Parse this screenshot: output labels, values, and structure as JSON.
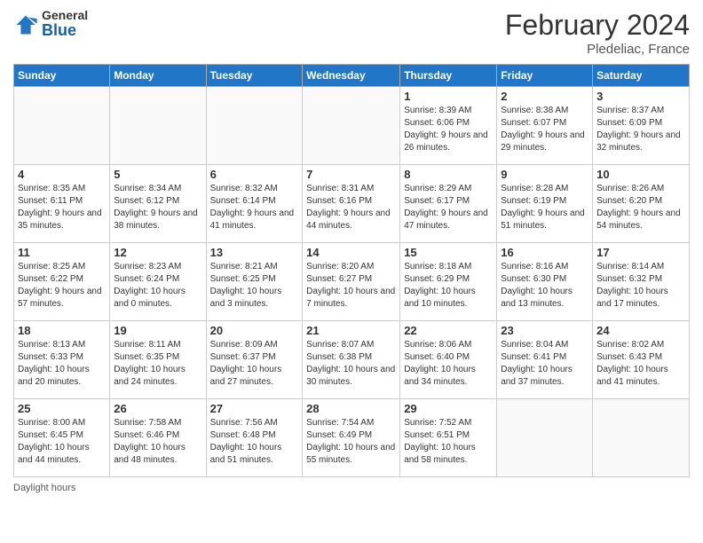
{
  "logo": {
    "general": "General",
    "blue": "Blue"
  },
  "header": {
    "month": "February 2024",
    "location": "Pledeliac, France"
  },
  "weekdays": [
    "Sunday",
    "Monday",
    "Tuesday",
    "Wednesday",
    "Thursday",
    "Friday",
    "Saturday"
  ],
  "weeks": [
    [
      {
        "day": "",
        "info": ""
      },
      {
        "day": "",
        "info": ""
      },
      {
        "day": "",
        "info": ""
      },
      {
        "day": "",
        "info": ""
      },
      {
        "day": "1",
        "info": "Sunrise: 8:39 AM\nSunset: 6:06 PM\nDaylight: 9 hours and 26 minutes."
      },
      {
        "day": "2",
        "info": "Sunrise: 8:38 AM\nSunset: 6:07 PM\nDaylight: 9 hours and 29 minutes."
      },
      {
        "day": "3",
        "info": "Sunrise: 8:37 AM\nSunset: 6:09 PM\nDaylight: 9 hours and 32 minutes."
      }
    ],
    [
      {
        "day": "4",
        "info": "Sunrise: 8:35 AM\nSunset: 6:11 PM\nDaylight: 9 hours and 35 minutes."
      },
      {
        "day": "5",
        "info": "Sunrise: 8:34 AM\nSunset: 6:12 PM\nDaylight: 9 hours and 38 minutes."
      },
      {
        "day": "6",
        "info": "Sunrise: 8:32 AM\nSunset: 6:14 PM\nDaylight: 9 hours and 41 minutes."
      },
      {
        "day": "7",
        "info": "Sunrise: 8:31 AM\nSunset: 6:16 PM\nDaylight: 9 hours and 44 minutes."
      },
      {
        "day": "8",
        "info": "Sunrise: 8:29 AM\nSunset: 6:17 PM\nDaylight: 9 hours and 47 minutes."
      },
      {
        "day": "9",
        "info": "Sunrise: 8:28 AM\nSunset: 6:19 PM\nDaylight: 9 hours and 51 minutes."
      },
      {
        "day": "10",
        "info": "Sunrise: 8:26 AM\nSunset: 6:20 PM\nDaylight: 9 hours and 54 minutes."
      }
    ],
    [
      {
        "day": "11",
        "info": "Sunrise: 8:25 AM\nSunset: 6:22 PM\nDaylight: 9 hours and 57 minutes."
      },
      {
        "day": "12",
        "info": "Sunrise: 8:23 AM\nSunset: 6:24 PM\nDaylight: 10 hours and 0 minutes."
      },
      {
        "day": "13",
        "info": "Sunrise: 8:21 AM\nSunset: 6:25 PM\nDaylight: 10 hours and 3 minutes."
      },
      {
        "day": "14",
        "info": "Sunrise: 8:20 AM\nSunset: 6:27 PM\nDaylight: 10 hours and 7 minutes."
      },
      {
        "day": "15",
        "info": "Sunrise: 8:18 AM\nSunset: 6:29 PM\nDaylight: 10 hours and 10 minutes."
      },
      {
        "day": "16",
        "info": "Sunrise: 8:16 AM\nSunset: 6:30 PM\nDaylight: 10 hours and 13 minutes."
      },
      {
        "day": "17",
        "info": "Sunrise: 8:14 AM\nSunset: 6:32 PM\nDaylight: 10 hours and 17 minutes."
      }
    ],
    [
      {
        "day": "18",
        "info": "Sunrise: 8:13 AM\nSunset: 6:33 PM\nDaylight: 10 hours and 20 minutes."
      },
      {
        "day": "19",
        "info": "Sunrise: 8:11 AM\nSunset: 6:35 PM\nDaylight: 10 hours and 24 minutes."
      },
      {
        "day": "20",
        "info": "Sunrise: 8:09 AM\nSunset: 6:37 PM\nDaylight: 10 hours and 27 minutes."
      },
      {
        "day": "21",
        "info": "Sunrise: 8:07 AM\nSunset: 6:38 PM\nDaylight: 10 hours and 30 minutes."
      },
      {
        "day": "22",
        "info": "Sunrise: 8:06 AM\nSunset: 6:40 PM\nDaylight: 10 hours and 34 minutes."
      },
      {
        "day": "23",
        "info": "Sunrise: 8:04 AM\nSunset: 6:41 PM\nDaylight: 10 hours and 37 minutes."
      },
      {
        "day": "24",
        "info": "Sunrise: 8:02 AM\nSunset: 6:43 PM\nDaylight: 10 hours and 41 minutes."
      }
    ],
    [
      {
        "day": "25",
        "info": "Sunrise: 8:00 AM\nSunset: 6:45 PM\nDaylight: 10 hours and 44 minutes."
      },
      {
        "day": "26",
        "info": "Sunrise: 7:58 AM\nSunset: 6:46 PM\nDaylight: 10 hours and 48 minutes."
      },
      {
        "day": "27",
        "info": "Sunrise: 7:56 AM\nSunset: 6:48 PM\nDaylight: 10 hours and 51 minutes."
      },
      {
        "day": "28",
        "info": "Sunrise: 7:54 AM\nSunset: 6:49 PM\nDaylight: 10 hours and 55 minutes."
      },
      {
        "day": "29",
        "info": "Sunrise: 7:52 AM\nSunset: 6:51 PM\nDaylight: 10 hours and 58 minutes."
      },
      {
        "day": "",
        "info": ""
      },
      {
        "day": "",
        "info": ""
      }
    ]
  ],
  "footer": {
    "label": "Daylight hours"
  }
}
